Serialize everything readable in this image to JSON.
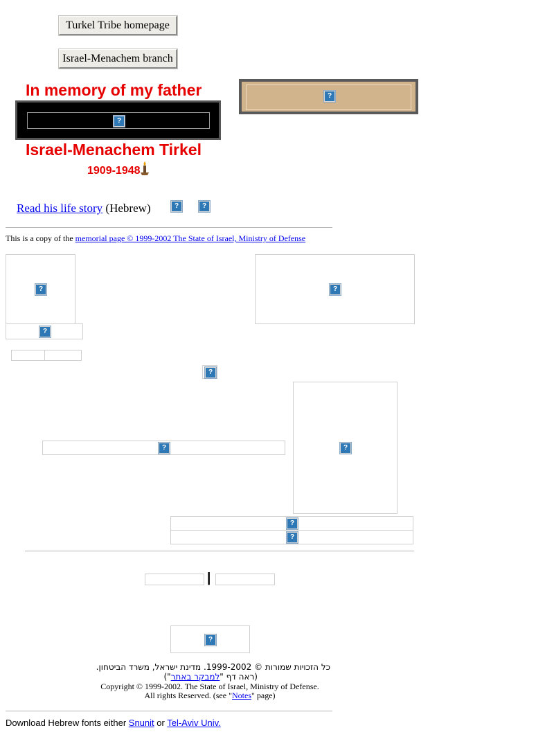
{
  "nav": {
    "home_button": "Turkel Tribe homepage",
    "branch_button": "Israel-Menachem branch"
  },
  "memorial": {
    "heading": "In memory of my father",
    "name": "Israel-Menachem Tirkel",
    "years": "1909-1948"
  },
  "life_story": {
    "link": "Read his life story",
    "suffix": "(Hebrew)"
  },
  "copy_note": {
    "prefix": "This is a copy of the",
    "link": "memorial page © 1999-2002 The State of Israel, Ministry of Defense"
  },
  "separator": "|",
  "footer": {
    "hebrew_line1": "כל הזכויות שמורות © 1999-2002. מדינת ישראל, משרד הביטחון.",
    "hebrew_line2_prefix": "(ראה דף \"",
    "hebrew_line2_link": "למבקר באתר",
    "hebrew_line2_suffix": "\")",
    "copyright_line": "Copyright © 1999-2002. The State of Israel, Ministry of Defense.",
    "rights_prefix": "All rights Reserved. (see \"",
    "notes_link": "Notes",
    "rights_suffix": "\" page)"
  },
  "fonts_note": {
    "prefix": "Download Hebrew fonts either",
    "link1": "Snunit",
    "middle": "or",
    "link2": "Tel-Aviv Univ."
  },
  "icons": {
    "broken_image": "broken-image-icon",
    "candle": "candle-icon"
  }
}
